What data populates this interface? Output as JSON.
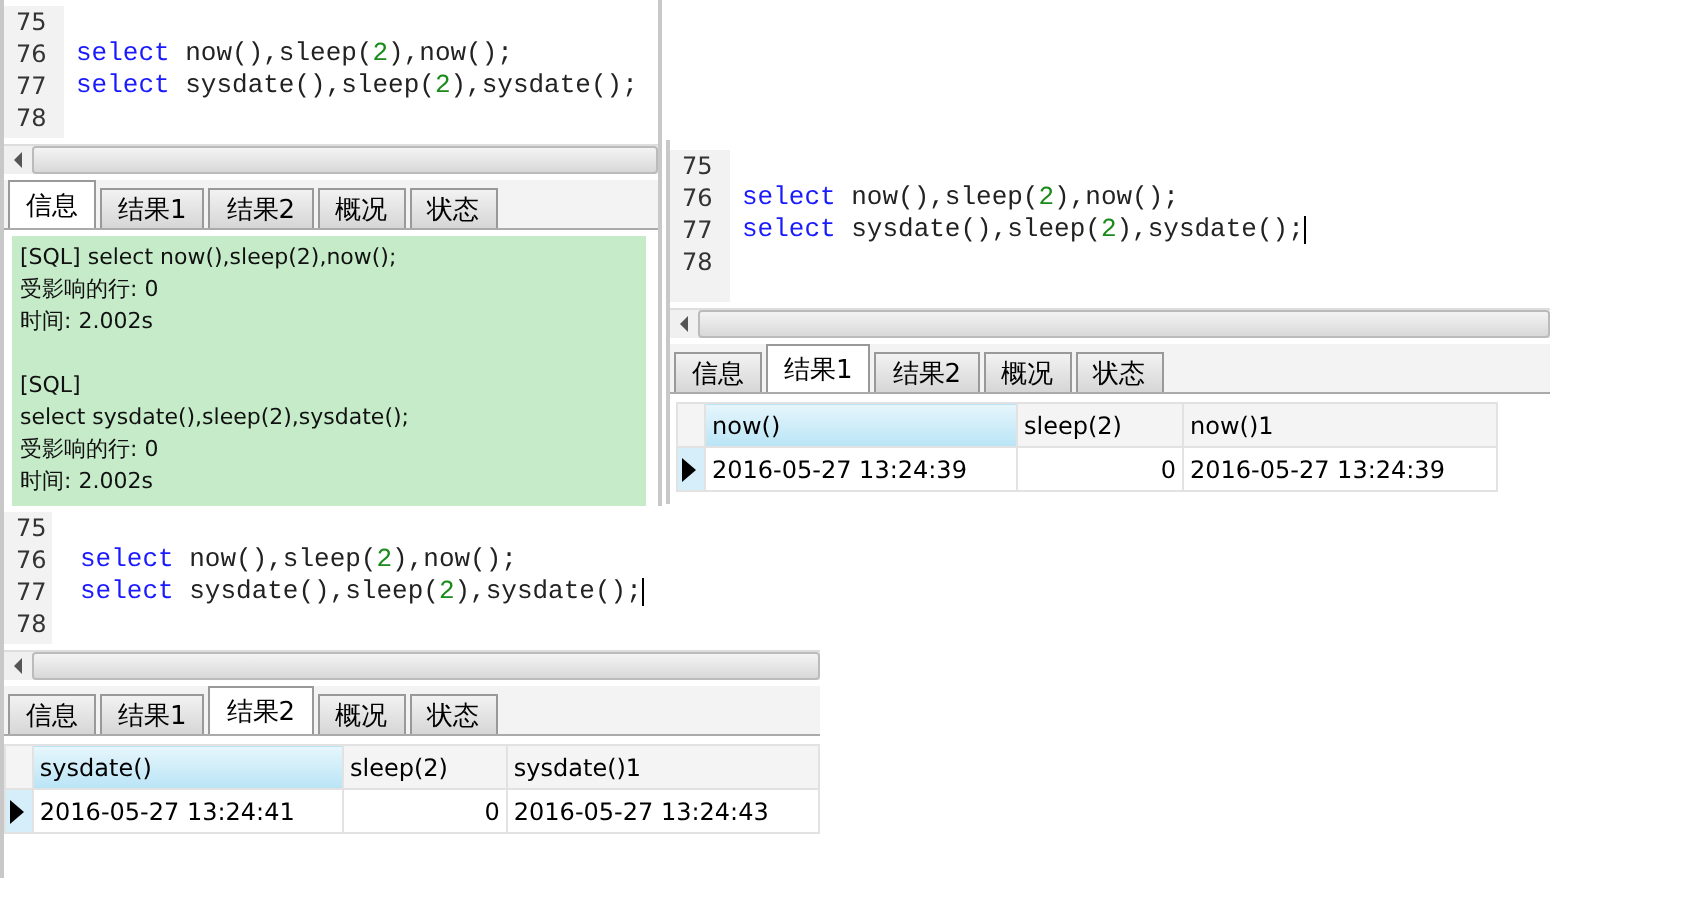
{
  "windows": [
    {
      "editor": {
        "lines": [
          {
            "number": "75",
            "cursor": false
          },
          {
            "number": "76",
            "segments": [
              {
                "kind": "keyword",
                "text": "select"
              },
              {
                "kind": "plain",
                "text": " now(),sleep("
              },
              {
                "kind": "number",
                "text": "2"
              },
              {
                "kind": "plain",
                "text": "),now();"
              }
            ],
            "cursor": false
          },
          {
            "number": "77",
            "segments": [
              {
                "kind": "keyword",
                "text": "select"
              },
              {
                "kind": "plain",
                "text": " sysdate(),sleep("
              },
              {
                "kind": "number",
                "text": "2"
              },
              {
                "kind": "plain",
                "text": "),sysdate();"
              }
            ],
            "cursor": false
          },
          {
            "number": "78",
            "cursor": false
          }
        ]
      },
      "tabs": [
        {
          "label": "信息",
          "selected": true
        },
        {
          "label": "结果1",
          "selected": false
        },
        {
          "label": "结果2",
          "selected": false
        },
        {
          "label": "概况",
          "selected": false
        },
        {
          "label": "状态",
          "selected": false
        }
      ],
      "result": {
        "kind": "info",
        "blocks": [
          [
            "[SQL] select now(),sleep(2),now();",
            "受影响的行: 0",
            "时间: 2.002s"
          ],
          [
            "[SQL]",
            "select sysdate(),sleep(2),sysdate();",
            "受影响的行: 0",
            "时间: 2.002s"
          ]
        ]
      }
    },
    {
      "editor": {
        "lines": [
          {
            "number": "75",
            "cursor": false
          },
          {
            "number": "76",
            "segments": [
              {
                "kind": "keyword",
                "text": "select"
              },
              {
                "kind": "plain",
                "text": " now(),sleep("
              },
              {
                "kind": "number",
                "text": "2"
              },
              {
                "kind": "plain",
                "text": "),now();"
              }
            ],
            "cursor": false
          },
          {
            "number": "77",
            "segments": [
              {
                "kind": "keyword",
                "text": "select"
              },
              {
                "kind": "plain",
                "text": " sysdate(),sleep("
              },
              {
                "kind": "number",
                "text": "2"
              },
              {
                "kind": "plain",
                "text": "),sysdate();"
              }
            ],
            "cursor": true
          },
          {
            "number": "78",
            "cursor": false
          }
        ]
      },
      "tabs": [
        {
          "label": "信息",
          "selected": false
        },
        {
          "label": "结果1",
          "selected": true
        },
        {
          "label": "结果2",
          "selected": false
        },
        {
          "label": "概况",
          "selected": false
        },
        {
          "label": "状态",
          "selected": false
        }
      ],
      "result": {
        "kind": "grid",
        "columns": [
          {
            "label": "now()",
            "selected": true,
            "kind": "text"
          },
          {
            "label": "sleep(2)",
            "selected": false,
            "kind": "number"
          },
          {
            "label": "now()1",
            "selected": false,
            "kind": "text"
          }
        ],
        "rows": [
          {
            "current": true,
            "cells": [
              "2016-05-27 13:24:39",
              "0",
              "2016-05-27 13:24:39"
            ]
          }
        ]
      }
    },
    {
      "editor": {
        "lines": [
          {
            "number": "75",
            "cursor": false
          },
          {
            "number": "76",
            "segments": [
              {
                "kind": "keyword",
                "text": "select"
              },
              {
                "kind": "plain",
                "text": " now(),sleep("
              },
              {
                "kind": "number",
                "text": "2"
              },
              {
                "kind": "plain",
                "text": "),now();"
              }
            ],
            "cursor": false
          },
          {
            "number": "77",
            "segments": [
              {
                "kind": "keyword",
                "text": "select"
              },
              {
                "kind": "plain",
                "text": " sysdate(),sleep("
              },
              {
                "kind": "number",
                "text": "2"
              },
              {
                "kind": "plain",
                "text": "),sysdate();"
              }
            ],
            "cursor": true
          },
          {
            "number": "78",
            "cursor": false
          }
        ]
      },
      "tabs": [
        {
          "label": "信息",
          "selected": false
        },
        {
          "label": "结果1",
          "selected": false
        },
        {
          "label": "结果2",
          "selected": true
        },
        {
          "label": "概况",
          "selected": false
        },
        {
          "label": "状态",
          "selected": false
        }
      ],
      "result": {
        "kind": "grid",
        "columns": [
          {
            "label": "sysdate()",
            "selected": true,
            "kind": "text"
          },
          {
            "label": "sleep(2)",
            "selected": false,
            "kind": "number"
          },
          {
            "label": "sysdate()1",
            "selected": false,
            "kind": "text"
          }
        ],
        "rows": [
          {
            "current": true,
            "cells": [
              "2016-05-27 13:24:41",
              "0",
              "2016-05-27 13:24:43"
            ]
          }
        ]
      }
    }
  ]
}
